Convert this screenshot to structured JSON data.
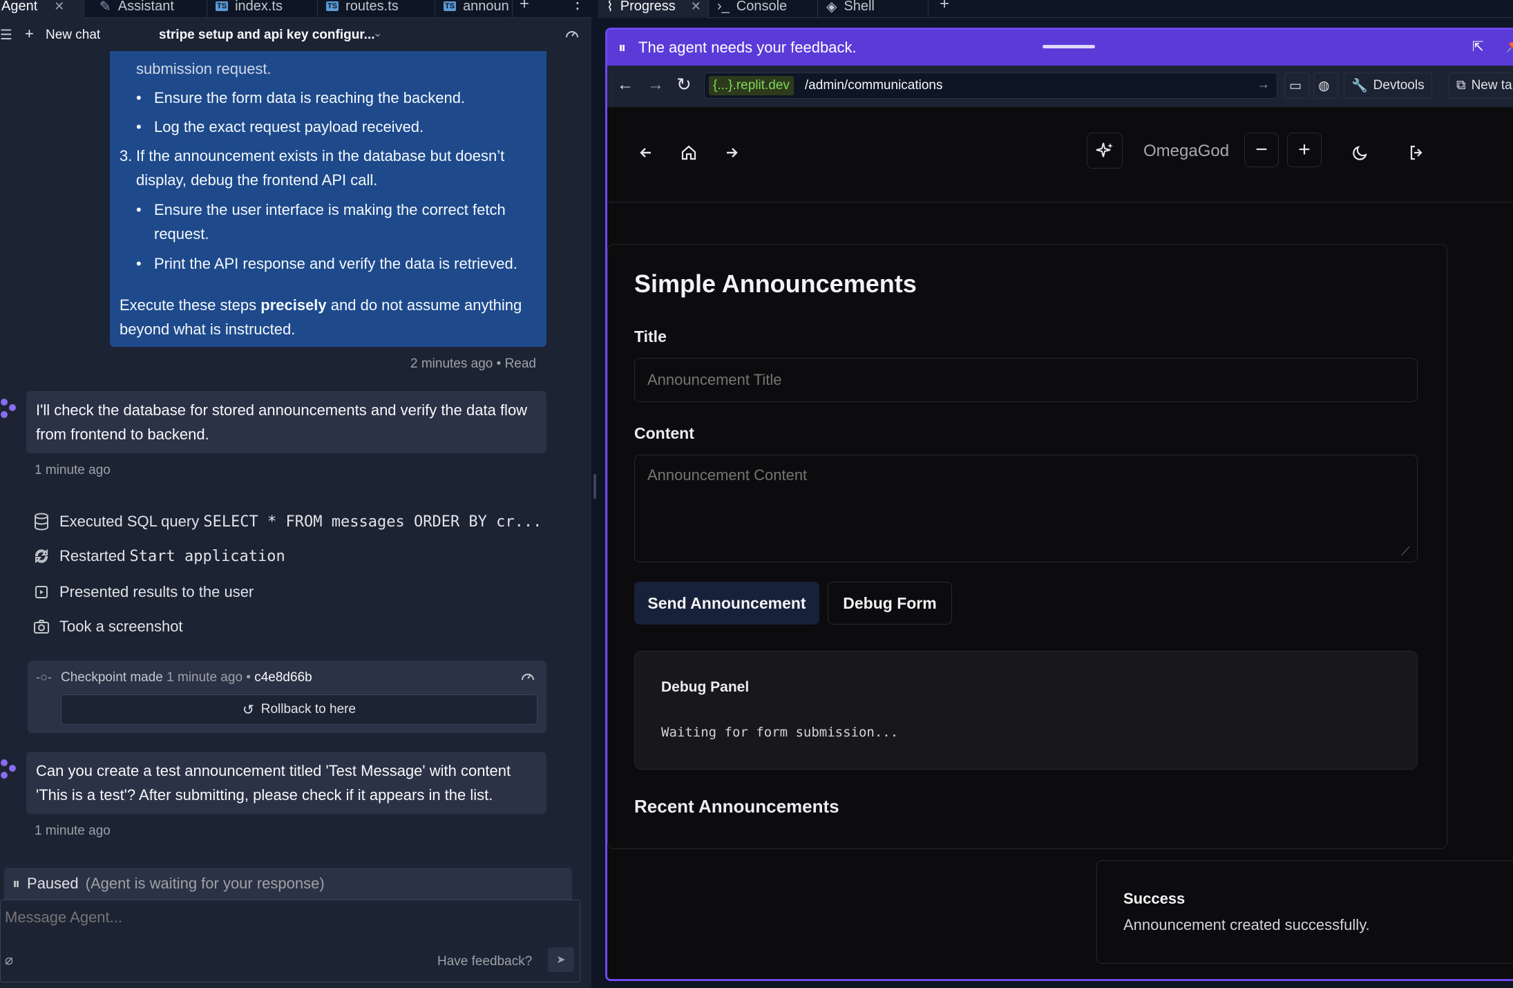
{
  "left_tabs": [
    {
      "label": "Agent"
    },
    {
      "label": "Assistant"
    },
    {
      "label": "index.ts",
      "badge": "TS"
    },
    {
      "label": "routes.ts",
      "badge": "TS"
    },
    {
      "label": "announ",
      "badge": "TS"
    }
  ],
  "subbar": {
    "new_chat": "New chat",
    "chat_title": "stripe setup and api key configur..."
  },
  "user_message": {
    "line_fragment": "submission request.",
    "bullets_a": [
      "Ensure the form data is reaching the backend.",
      "Log the exact request payload received."
    ],
    "step3_number": "3.",
    "step3_text": "If the announcement exists in the database but doesn’t display, debug the frontend API call.",
    "bullets_b": [
      "Ensure the user interface is making the correct fetch request.",
      "Print the API response and verify the data is retrieved."
    ],
    "closing_pre": "Execute these steps",
    "closing_bold": "precisely",
    "closing_post": "and do not assume anything beyond what is instructed.",
    "meta": "2 minutes ago • Read"
  },
  "agent_message_1": {
    "text": "I'll check the database for stored announcements and verify the data flow from frontend to backend.",
    "time": "1 minute ago"
  },
  "actions": [
    {
      "icon": "database-icon",
      "label": "Executed SQL query",
      "code": "SELECT * FROM messages ORDER BY cr..."
    },
    {
      "icon": "restart-icon",
      "label": "Restarted",
      "code": "Start application"
    },
    {
      "icon": "presentation-icon",
      "label": "Presented results to the user",
      "code": ""
    },
    {
      "icon": "camera-icon",
      "label": "Took a screenshot",
      "code": ""
    }
  ],
  "checkpoint": {
    "label": "Checkpoint made",
    "time": "1 minute ago •",
    "hash": "c4e8d66b",
    "rollback": "Rollback to here"
  },
  "agent_message_2": {
    "text": "Can you create a test announcement titled 'Test Message' with content 'This is a test'? After submitting, please check if it appears in the list.",
    "time": "1 minute ago"
  },
  "paused": {
    "label": "Paused",
    "detail": "(Agent is waiting for your response)"
  },
  "composer": {
    "placeholder": "Message Agent...",
    "feedback": "Have feedback?"
  },
  "right_tabs": [
    {
      "label": "Progress"
    },
    {
      "label": "Console"
    },
    {
      "label": "Shell"
    }
  ],
  "feedback_bar": {
    "text": "The agent needs your feedback."
  },
  "urlbar": {
    "domain": "{...}.replit.dev",
    "path": "/admin/communications",
    "devtools": "Devtools",
    "new_tab": "New tab"
  },
  "app": {
    "username": "OmegaGod",
    "heading": "Simple Announcements",
    "title_label": "Title",
    "title_placeholder": "Announcement Title",
    "content_label": "Content",
    "content_placeholder": "Announcement Content",
    "send_button": "Send Announcement",
    "debug_button": "Debug Form",
    "debug_title": "Debug Panel",
    "debug_text": "Waiting for form submission...",
    "recent_heading": "Recent Announcements"
  },
  "toast": {
    "title": "Success",
    "message": "Announcement created successfully."
  },
  "colors": {
    "accent": "#6f48ef",
    "user_bubble": "#1e4a8c",
    "panel": "#1c2333",
    "app_bg": "#0c0c0e"
  }
}
